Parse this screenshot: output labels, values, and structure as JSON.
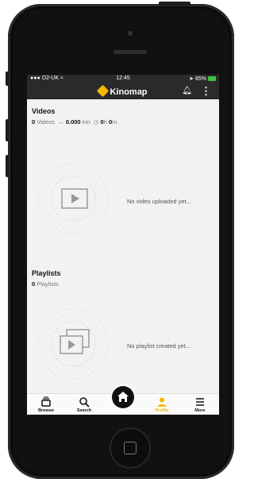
{
  "status": {
    "carrier": "O2-UK",
    "time": "12:45",
    "battery": "85%"
  },
  "app": {
    "brand": "Kinomap"
  },
  "videos": {
    "title": "Videos",
    "count": "0",
    "count_label": "Videos",
    "distance": "0.000",
    "distance_unit": "km",
    "hours": "0",
    "hours_unit": "h",
    "minutes": "0",
    "minutes_unit": "m",
    "empty_message": "No video uploaded yet..."
  },
  "playlists": {
    "title": "Playlists",
    "count": "0",
    "count_label": "Playlists",
    "empty_message": "No playlist created yet..."
  },
  "tabs": [
    {
      "label": "Browse",
      "icon": "tray-icon"
    },
    {
      "label": "Search",
      "icon": "search-icon"
    },
    {
      "label": "",
      "icon": "home-icon"
    },
    {
      "label": "Profile",
      "icon": "user-icon"
    },
    {
      "label": "More",
      "icon": "menu-icon"
    }
  ],
  "colors": {
    "accent": "#f5b800",
    "header": "#2a2a2a",
    "background": "#f2f2f2"
  }
}
